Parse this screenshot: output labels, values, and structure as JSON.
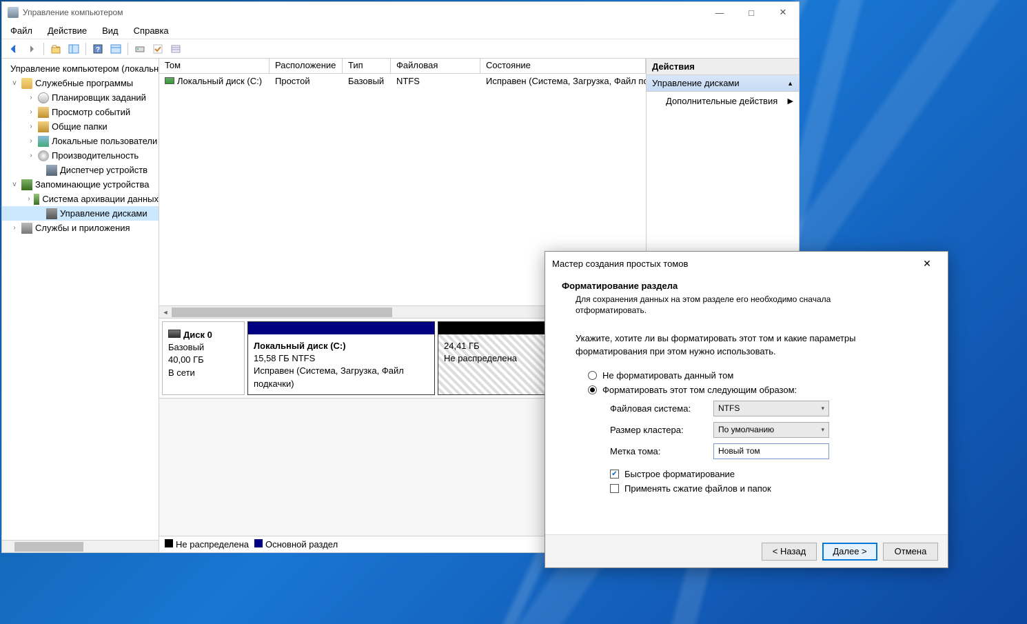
{
  "window": {
    "title": "Управление компьютером"
  },
  "menu": {
    "file": "Файл",
    "action": "Действие",
    "view": "Вид",
    "help": "Справка"
  },
  "tree": {
    "root": "Управление компьютером (локальным)",
    "sys_tools": "Служебные программы",
    "task_scheduler": "Планировщик заданий",
    "event_viewer": "Просмотр событий",
    "shared_folders": "Общие папки",
    "local_users": "Локальные пользователи",
    "performance": "Производительность",
    "device_mgr": "Диспетчер устройств",
    "storage": "Запоминающие устройства",
    "backup": "Система архивации данных",
    "disk_mgmt": "Управление дисками",
    "services": "Службы и приложения"
  },
  "vol_headers": {
    "volume": "Том",
    "layout": "Расположение",
    "type": "Тип",
    "fs": "Файловая система",
    "status": "Состояние"
  },
  "vol_row": {
    "name": "Локальный диск (C:)",
    "layout": "Простой",
    "type": "Базовый",
    "fs": "NTFS",
    "status": "Исправен (Система, Загрузка, Файл подкачки)"
  },
  "disk0": {
    "title": "Диск 0",
    "type": "Базовый",
    "size": "40,00 ГБ",
    "state": "В сети",
    "part1_name": "Локальный диск  (C:)",
    "part1_info": "15,58 ГБ NTFS",
    "part1_status": "Исправен (Система, Загрузка, Файл подкачки)",
    "part2_size": "24,41 ГБ",
    "part2_status": "Не распределена"
  },
  "legend": {
    "unalloc": "Не распределена",
    "primary": "Основной раздел"
  },
  "actions": {
    "header": "Действия",
    "disk_mgmt": "Управление дисками",
    "more": "Дополнительные действия"
  },
  "wizard": {
    "title": "Мастер создания простых томов",
    "heading": "Форматирование раздела",
    "subheading": "Для сохранения данных на этом разделе его необходимо сначала отформатировать.",
    "instruction": "Укажите, хотите ли вы форматировать этот том и какие параметры форматирования при этом нужно использовать.",
    "opt_no_format": "Не форматировать данный том",
    "opt_format": "Форматировать этот том следующим образом:",
    "lbl_fs": "Файловая система:",
    "val_fs": "NTFS",
    "lbl_cluster": "Размер кластера:",
    "val_cluster": "По умолчанию",
    "lbl_label": "Метка тома:",
    "val_label": "Новый том",
    "chk_quick": "Быстрое форматирование",
    "chk_compress": "Применять сжатие файлов и папок",
    "btn_back": "< Назад",
    "btn_next": "Далее >",
    "btn_cancel": "Отмена"
  }
}
